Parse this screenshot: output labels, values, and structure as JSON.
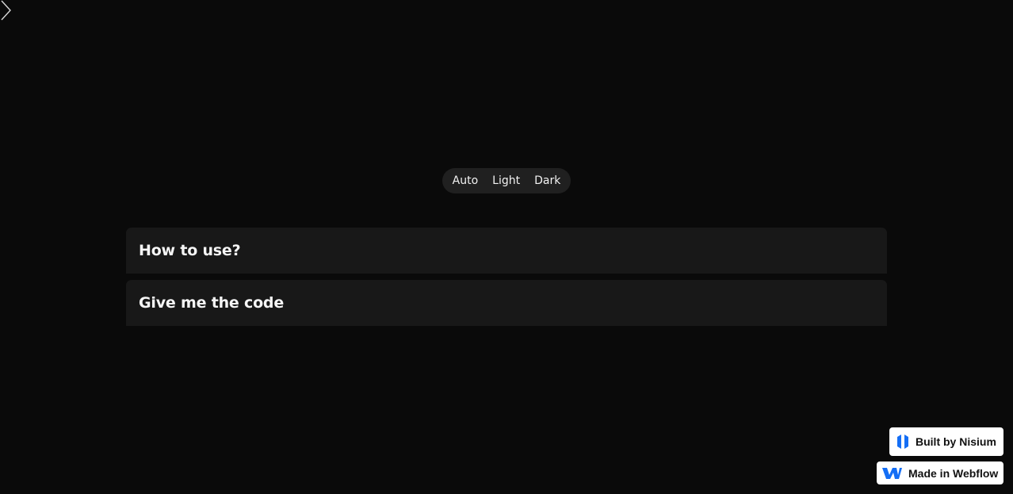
{
  "theme_switch": {
    "options": [
      "Auto",
      "Light",
      "Dark"
    ]
  },
  "accordions": [
    {
      "title": "How to use?"
    },
    {
      "title": "Give me the code"
    }
  ],
  "badges": {
    "nisium": {
      "label": "Built by Nisium",
      "icon": "nisium-logo-icon"
    },
    "webflow": {
      "label": "Made in Webflow",
      "icon": "webflow-logo-icon"
    }
  },
  "colors": {
    "background": "#0a0a0a",
    "panel": "#181818",
    "switch_bg": "#202020",
    "text": "#f5f5f5",
    "brand_blue": "#146ef5"
  }
}
